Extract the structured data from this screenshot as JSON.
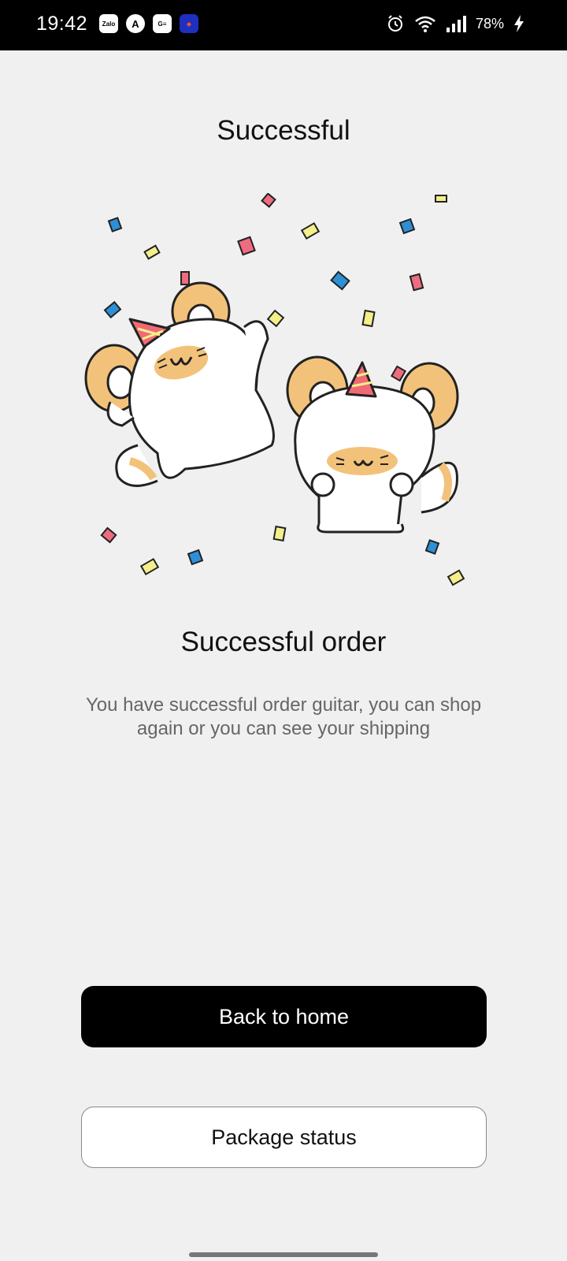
{
  "status_bar": {
    "time": "19:42",
    "battery": "78%",
    "notification_apps": [
      "Zalo",
      "A",
      "G≡",
      "app"
    ]
  },
  "page": {
    "title": "Successful",
    "heading": "Successful order",
    "message": "You have successful order guitar, you can shop again or you can see your shipping"
  },
  "actions": {
    "back_home_label": "Back to home",
    "package_status_label": "Package status"
  },
  "colors": {
    "background": "#f0f0f0",
    "primary_button": "#000000",
    "secondary_button": "#ffffff",
    "cat_ears": "#f3c27a",
    "party_hat": "#f06a75"
  },
  "icons": [
    "alarm-icon",
    "wifi-icon",
    "signal-icon",
    "charging-icon"
  ]
}
